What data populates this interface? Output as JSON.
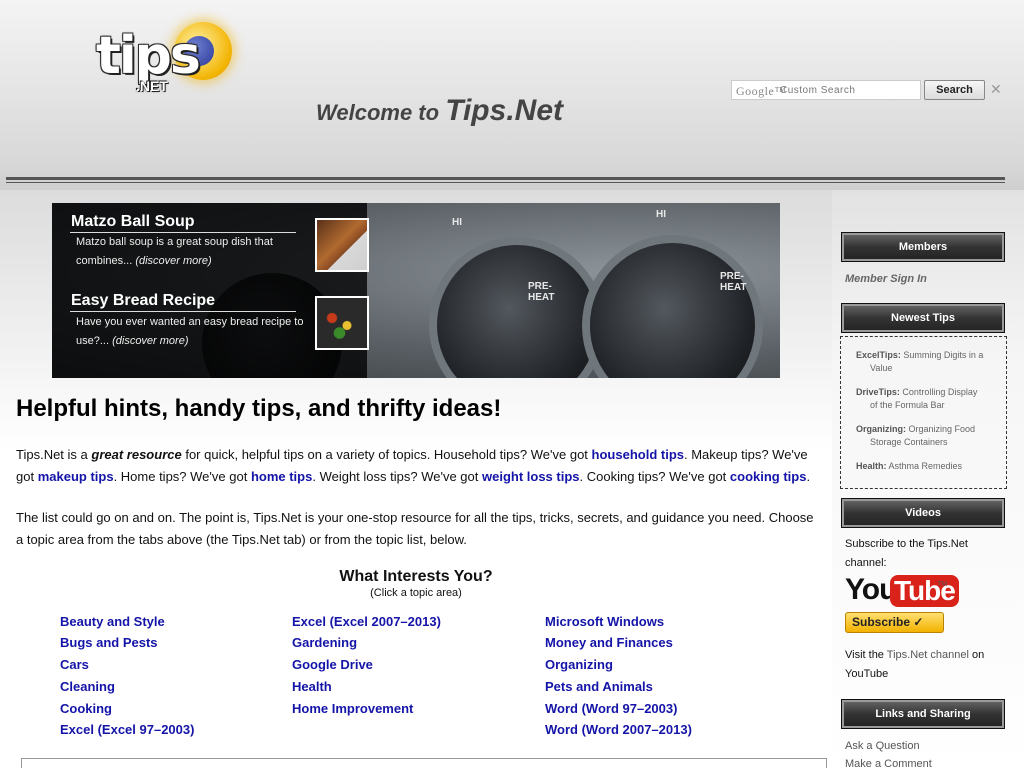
{
  "header": {
    "logo_word": "tips",
    "logo_net": ".NET",
    "welcome_prefix": "Welcome to",
    "welcome_brand": "Tips.Net",
    "search": {
      "google_mark": "Google™",
      "placeholder": "Custom Search",
      "button_label": "Search",
      "clear_glyph": "✕"
    }
  },
  "banner": {
    "features": [
      {
        "title": "Matzo Ball Soup",
        "text": "Matzo ball soup is a great soup dish that combines...",
        "more": "(discover more)"
      },
      {
        "title": "Easy Bread Recipe",
        "text": "Have you ever wanted an easy bread recipe to use?...",
        "more": "(discover more)"
      }
    ],
    "dial_labels": {
      "hi_1": "HI",
      "hi_2": "HI",
      "preheat_1": "PRE-\nHEAT",
      "preheat_2": "PRE-\nHEAT"
    }
  },
  "main": {
    "headline": "Helpful hints, handy tips, and thrifty ideas!",
    "intro": {
      "p1": "Tips.Net is a",
      "p1_emph": "great resource",
      "p2": "for quick, helpful tips on a variety of topics. Household tips? We've got",
      "link_household": "household tips",
      "p3": ". Makeup tips? We've got",
      "link_makeup": "makeup tips",
      "p4": ". Home tips? We've got",
      "link_home": "home tips",
      "p5": ". Weight loss tips? We've got",
      "link_weight": "weight loss tips",
      "p6": ". Cooking tips? We've got",
      "link_cooking": "cooking tips",
      "p7": "."
    },
    "para2": "The list could go on and on. The point is, Tips.Net is your one-stop resource for all the tips, tricks, secrets, and guidance you need. Choose a topic area from the tabs above (the Tips.Net tab) or from the topic list, below.",
    "interests_title": "What Interests You?",
    "interests_sub": "(Click a topic area)",
    "topics_col1": [
      "Beauty and Style",
      "Bugs and Pests",
      "Cars",
      "Cleaning",
      "Cooking",
      "Excel (Excel 97–2003)"
    ],
    "topics_col2": [
      "Excel (Excel 2007–2013)",
      "Gardening",
      "Google Drive",
      "Health",
      "Home Improvement"
    ],
    "topics_col3": [
      "Microsoft Windows",
      "Money and Finances",
      "Organizing",
      "Pets and Animals",
      "Word (Word 97–2003)",
      "Word (Word 2007–2013)"
    ]
  },
  "sidebar": {
    "members_head": "Members",
    "member_sign_in": "Member Sign In",
    "newest_head": "Newest Tips",
    "tips": [
      {
        "site": "ExcelTips:",
        "title_a": "Summing Digits in a",
        "title_b": "Value"
      },
      {
        "site": "DriveTips:",
        "title_a": "Controlling Display",
        "title_b": "of the Formula Bar"
      },
      {
        "site": "Organizing:",
        "title_a": "Organizing Food",
        "title_b": "Storage Containers"
      },
      {
        "site": "Health:",
        "title_a": "Asthma Remedies",
        "title_b": ""
      }
    ],
    "videos_head": "Videos",
    "videos_text": "Subscribe to the Tips.Net channel:",
    "yt_you": "You",
    "yt_tube": "Tube",
    "yt_tm": "TM",
    "yt_subscribe": "Subscribe ✓",
    "visit_a": "Visit the",
    "visit_link": "Tips.Net channel",
    "visit_b": "on YouTube",
    "links_head": "Links and Sharing",
    "ask": "Ask a Question",
    "comment": "Make a Comment"
  }
}
